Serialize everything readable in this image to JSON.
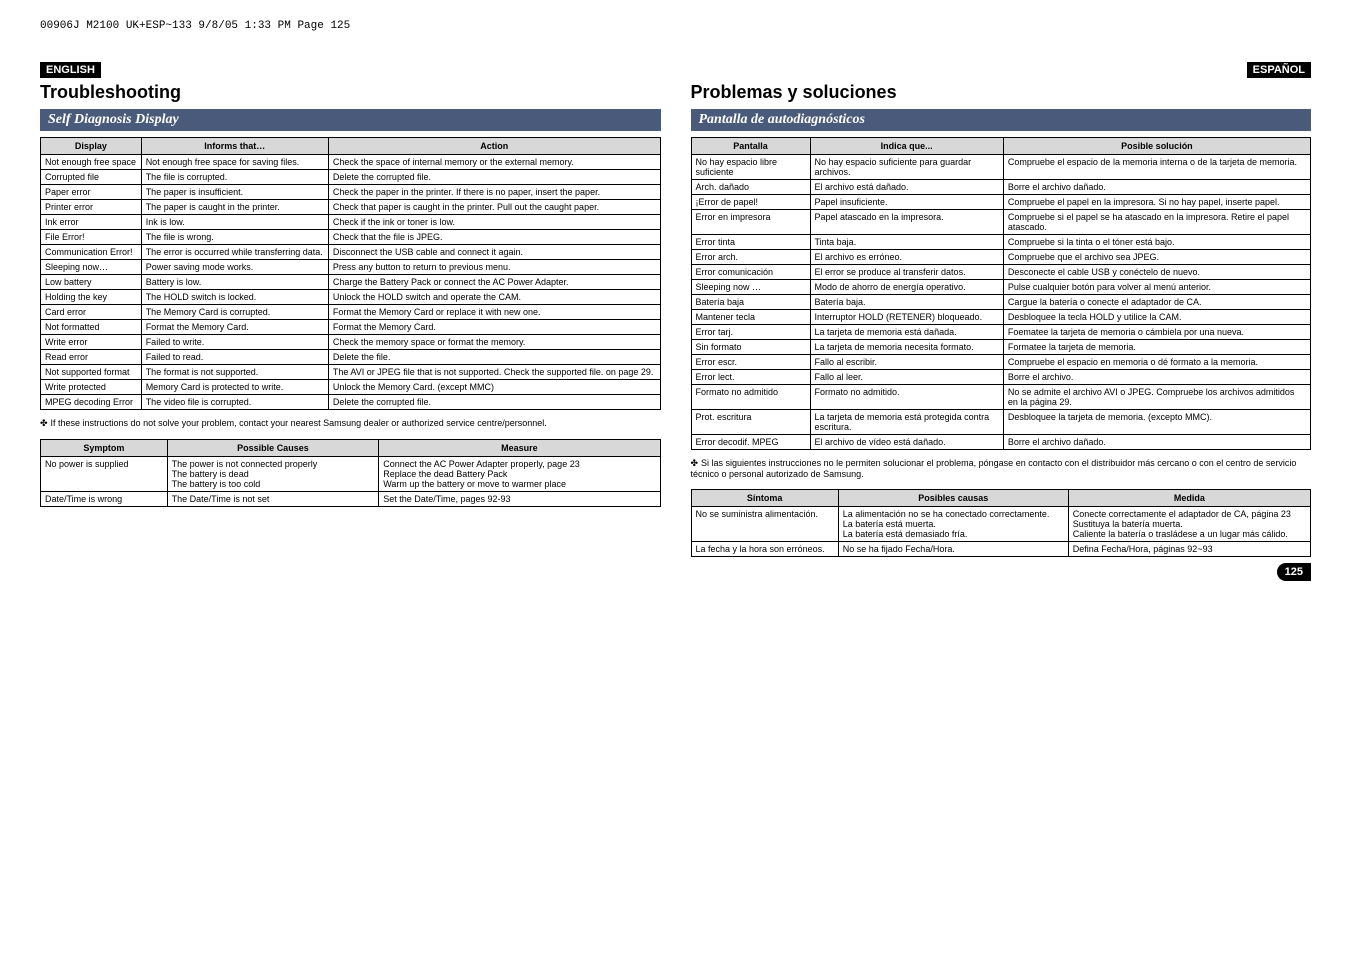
{
  "print_header": "00906J M2100 UK+ESP~133  9/8/05 1:33 PM  Page 125",
  "left": {
    "lang": "ENGLISH",
    "title": "Troubleshooting",
    "section": "Self Diagnosis Display",
    "headers": [
      "Display",
      "Informs that…",
      "Action"
    ],
    "rows": [
      [
        "Not enough free space",
        "Not enough free space for saving files.",
        "Check the space of internal memory or the external memory."
      ],
      [
        "Corrupted file",
        "The file is corrupted.",
        "Delete the corrupted file."
      ],
      [
        "Paper error",
        "The paper is insufficient.",
        "Check the paper in the printer. If there is no paper, insert the paper."
      ],
      [
        "Printer error",
        "The paper is caught in the printer.",
        "Check that paper is caught in the printer. Pull out the caught paper."
      ],
      [
        "Ink error",
        "Ink is low.",
        "Check if the ink or toner is low."
      ],
      [
        "File Error!",
        "The file is wrong.",
        "Check that the file is JPEG."
      ],
      [
        "Communication Error!",
        "The error is occurred while transferring data.",
        "Disconnect the USB cable and connect it again."
      ],
      [
        "Sleeping now…",
        "Power saving mode works.",
        "Press any button to return to previous menu."
      ],
      [
        "Low battery",
        "Battery is low.",
        "Charge the Battery Pack or connect the AC Power Adapter."
      ],
      [
        "Holding the key",
        "The HOLD switch is locked.",
        "Unlock the HOLD switch and operate the CAM."
      ],
      [
        "Card error",
        "The Memory Card is corrupted.",
        "Format the Memory Card or replace it with new one."
      ],
      [
        "Not formatted",
        "Format the Memory Card.",
        "Format the Memory Card."
      ],
      [
        "Write error",
        "Failed to write.",
        "Check the memory space or format the memory."
      ],
      [
        "Read error",
        "Failed to read.",
        "Delete the file."
      ],
      [
        "Not supported format",
        "The format is not supported.",
        "The AVI or JPEG file that is not supported. Check the supported file. on page 29."
      ],
      [
        "Write protected",
        "Memory Card is protected to write.",
        "Unlock the Memory Card. (except MMC)"
      ],
      [
        "MPEG decoding Error",
        "The video file is corrupted.",
        "Delete the corrupted file."
      ]
    ],
    "note": "If these instructions do not solve your problem, contact your nearest Samsung dealer or authorized service centre/personnel.",
    "headers2": [
      "Symptom",
      "Possible Causes",
      "Measure"
    ],
    "rows2": [
      [
        "No power is supplied",
        "The power is not connected properly\nThe battery is dead\nThe battery is too cold",
        "Connect the AC Power Adapter properly, page 23\nReplace the dead Battery Pack\nWarm up the battery or move to warmer place"
      ],
      [
        "Date/Time is wrong",
        "The Date/Time is not set",
        "Set the Date/Time, pages 92-93"
      ]
    ]
  },
  "right": {
    "lang": "ESPAÑOL",
    "title": "Problemas y soluciones",
    "section": "Pantalla de autodiagnósticos",
    "headers": [
      "Pantalla",
      "Indica que...",
      "Posible solución"
    ],
    "rows": [
      [
        "No hay espacio libre suficiente",
        "No hay espacio suficiente para guardar archivos.",
        "Compruebe el espacio de la memoria interna o de la tarjeta de memoria."
      ],
      [
        "Arch. dañado",
        "El archivo está dañado.",
        "Borre el archivo dañado."
      ],
      [
        "¡Error de papel!",
        "Papel insuficiente.",
        "Compruebe el papel en la impresora. Si no hay papel, inserte papel."
      ],
      [
        "Error en impresora",
        "Papel atascado en la impresora.",
        "Compruebe si el papel se ha atascado en la impresora. Retire el papel atascado."
      ],
      [
        "Error tinta",
        "Tinta baja.",
        "Compruebe si la tinta o el tóner está bajo."
      ],
      [
        "Error arch.",
        "El archivo es erróneo.",
        "Compruebe que el archivo sea JPEG."
      ],
      [
        "Error comunicación",
        "El error se produce al transferir datos.",
        "Desconecte el cable USB y conéctelo de nuevo."
      ],
      [
        "Sleeping now …",
        "Modo de ahorro de energía operativo.",
        "Pulse cualquier botón para volver al menú anterior."
      ],
      [
        "Batería baja",
        "Batería baja.",
        "Cargue la batería o conecte el adaptador de CA."
      ],
      [
        "Mantener tecla",
        "Interruptor HOLD (RETENER) bloqueado.",
        "Desbloquee la tecla HOLD y utilice la CAM."
      ],
      [
        "Error tarj.",
        "La tarjeta de memoria está dañada.",
        "Foematee la tarjeta de memoria o cámbiela por una nueva."
      ],
      [
        "Sin formato",
        "La tarjeta de memoria necesita formato.",
        "Formatee la tarjeta de memoria."
      ],
      [
        "Error escr.",
        "Fallo al escribir.",
        "Compruebe el espacio en memoria o dé formato a la memoria."
      ],
      [
        "Error lect.",
        "Fallo al leer.",
        "Borre el archivo."
      ],
      [
        "Formato no admitido",
        "Formato no admitido.",
        "No se admite el archivo AVI o JPEG. Compruebe los archivos admitidos en la página 29."
      ],
      [
        "Prot. escritura",
        "La tarjeta de memoria está protegida contra escritura.",
        "Desbloquee la tarjeta de memoria. (excepto MMC)."
      ],
      [
        "Error decodif. MPEG",
        "El archivo de vídeo está dañado.",
        "Borre el archivo dañado."
      ]
    ],
    "note": "Si las siguientes instrucciones no le permiten solucionar el problema, póngase en contacto con el distribuidor más cercano o con el centro de servicio técnico o personal autorizado de Samsung.",
    "headers2": [
      "Síntoma",
      "Posibles causas",
      "Medida"
    ],
    "rows2": [
      [
        "No se suministra alimentación.",
        "La alimentación no se ha conectado correctamente.\nLa batería está muerta.\nLa batería está demasiado fría.",
        "Conecte correctamente el adaptador de CA, página 23\nSustituya la batería muerta.\nCaliente la batería o trasládese a un lugar más cálido."
      ],
      [
        "La fecha y la hora son erróneos.",
        "No se ha fijado Fecha/Hora.",
        "Defina Fecha/Hora, páginas 92~93"
      ]
    ]
  },
  "page_number": "125"
}
